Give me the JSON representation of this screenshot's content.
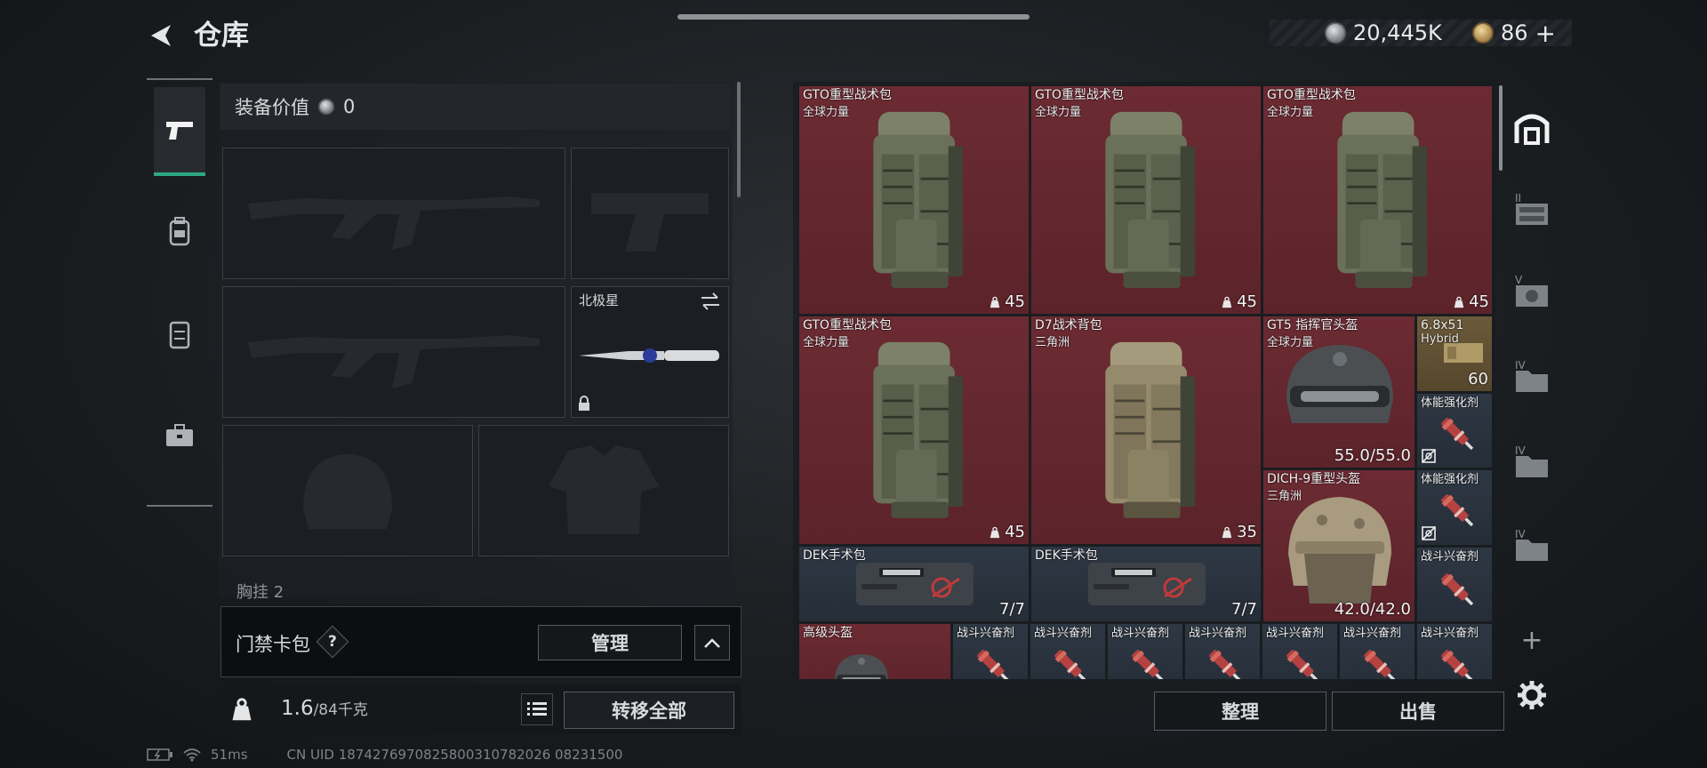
{
  "header": {
    "title": "仓库",
    "currency_main": "20,445K",
    "currency_premium": "86",
    "premium_plus": "+"
  },
  "equipment": {
    "value_label": "装备价值",
    "value": "0",
    "melee_name": "北极星",
    "chest_label": "胸挂",
    "chest_count": "2"
  },
  "keycard": {
    "label": "门禁卡包",
    "help": "?",
    "manage_label": "管理"
  },
  "bottom": {
    "weight_current": "1.6",
    "weight_max": "/84千克",
    "transfer_all_label": "转移全部"
  },
  "status": {
    "ping": "51ms",
    "uid": "CN UID 1874276970825800310782026 08231500"
  },
  "warehouse": {
    "sort_label": "整理",
    "sell_label": "出售",
    "add_label": "+",
    "items": [
      {
        "name": "GTO重型战术包",
        "sub": "全球力量",
        "count": "45"
      },
      {
        "name": "GTO重型战术包",
        "sub": "全球力量",
        "count": "45"
      },
      {
        "name": "GTO重型战术包",
        "sub": "全球力量",
        "count": "45"
      },
      {
        "name": "GTO重型战术包",
        "sub": "全球力量",
        "count": "45"
      },
      {
        "name": "D7战术背包",
        "sub": "三角洲",
        "count": "35"
      },
      {
        "name": "GT5 指挥官头盔",
        "sub": "全球力量",
        "count": "55.0/55.0"
      },
      {
        "name": "6.8x51",
        "sub": "Hybrid",
        "count": "60"
      },
      {
        "name": "体能强化剂"
      },
      {
        "name": "DICH-9重型头盔",
        "sub": "三角洲",
        "count": "42.0/42.0"
      },
      {
        "name": "体能强化剂"
      },
      {
        "name": "DEK手术包",
        "count": "7/7"
      },
      {
        "name": "DEK手术包",
        "count": "7/7"
      },
      {
        "name": "战斗兴奋剂"
      },
      {
        "name": "高级头盔"
      },
      {
        "name": "战斗兴奋剂"
      },
      {
        "name": "战斗兴奋剂"
      },
      {
        "name": "战斗兴奋剂"
      },
      {
        "name": "战斗兴奋剂"
      },
      {
        "name": "战斗兴奋剂"
      },
      {
        "name": "战斗兴奋剂"
      },
      {
        "name": "战斗兴奋剂"
      }
    ],
    "right_tabs": [
      {
        "label": ""
      },
      {
        "label": "II"
      },
      {
        "label": "V"
      },
      {
        "label": "IV"
      },
      {
        "label": "IV"
      },
      {
        "label": "IV"
      }
    ]
  },
  "colors": {
    "accent": "#2ea883",
    "item_red": "#6c2b33",
    "item_blue": "#2e3844"
  }
}
